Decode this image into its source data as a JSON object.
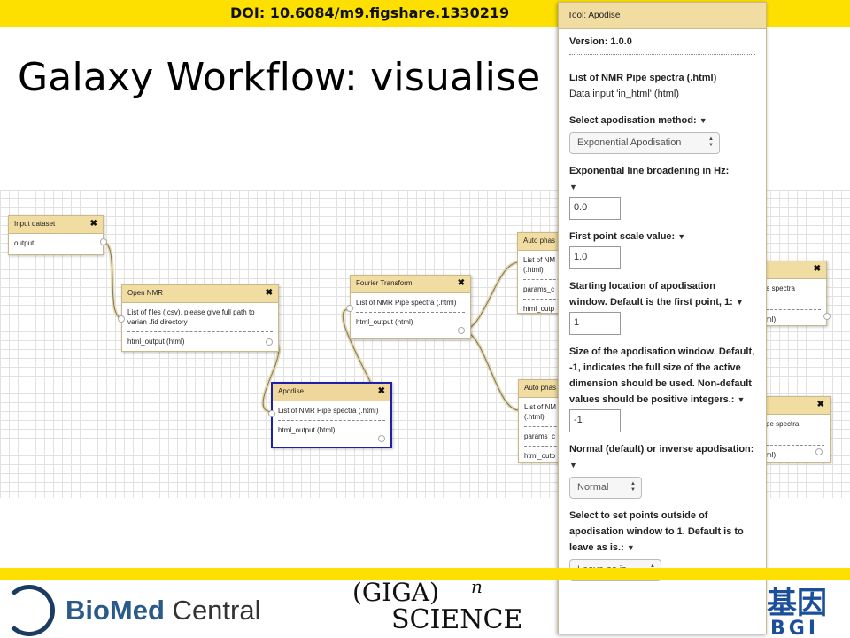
{
  "doi": "DOI: 10.6084/m9.figshare.1330219",
  "title": "Galaxy Workflow: visualise",
  "nodes": {
    "input_dataset": {
      "title": "Input dataset",
      "output": "output"
    },
    "open_nmr": {
      "title": "Open NMR",
      "input": "List of files (.csv), please give full path to varian .fid directory",
      "output": "html_output (html)"
    },
    "apodise": {
      "title": "Apodise",
      "input": "List of NMR Pipe spectra (.html)",
      "output": "html_output (html)"
    },
    "fourier": {
      "title": "Fourier Transform",
      "input": "List of NMR Pipe spectra (.html)",
      "output": "html_output (html)"
    },
    "auto_phase_1": {
      "title": "Auto phas",
      "input": "List of NM (.html)",
      "params": "params_c",
      "output": "html_outp"
    },
    "auto_phase_2": {
      "title": "Auto phas",
      "input": "List of NM (.html)",
      "params": "params_c",
      "output": "html_outp"
    },
    "right_1": {
      "input": "e spectra",
      "output": "ml)"
    },
    "right_2": {
      "input": "pe spectra",
      "output": "ml)"
    }
  },
  "tool": {
    "header": "Tool: Apodise",
    "version": "Version: 1.0.0",
    "input_label": "List of NMR Pipe spectra (.html)",
    "input_hint": "Data input 'in_html' (html)",
    "method_label": "Select apodisation method:",
    "method_value": "Exponential Apodisation",
    "broadening_label": "Exponential line broadening in Hz:",
    "broadening_value": "0.0",
    "scale_label": "First point scale value:",
    "scale_value": "1.0",
    "start_label": "Starting location of apodisation window. Default is the first point, 1:",
    "start_value": "1",
    "size_label": "Size of the apodisation window. Default, -1, indicates the full size of the active dimension should be used. Non-default values should be positive integers.:",
    "size_value": "-1",
    "inverse_label": "Normal (default) or inverse apodisation:",
    "inverse_value": "Normal",
    "outside_label": "Select to set points outside of apodisation window to 1. Default is to leave as is.:",
    "outside_value": "Leave as is",
    "close_glyph": "✖",
    "tri_glyph": "▼",
    "spin_up": "▲",
    "spin_down": "▼"
  },
  "logos": {
    "bmc_bold": "BioMed",
    "bmc_regular": " Central",
    "giga_top": "(GIGA)",
    "giga_sup": "n",
    "giga_bottom": "SCIENCE",
    "bgi_chars": "基因",
    "bgi_letters": "BGI"
  },
  "colors": {
    "bar": "#fde000",
    "node_header": "#f1dca1",
    "selected_border": "#1f1fa8",
    "bmc_blue": "#2a5a8a"
  }
}
